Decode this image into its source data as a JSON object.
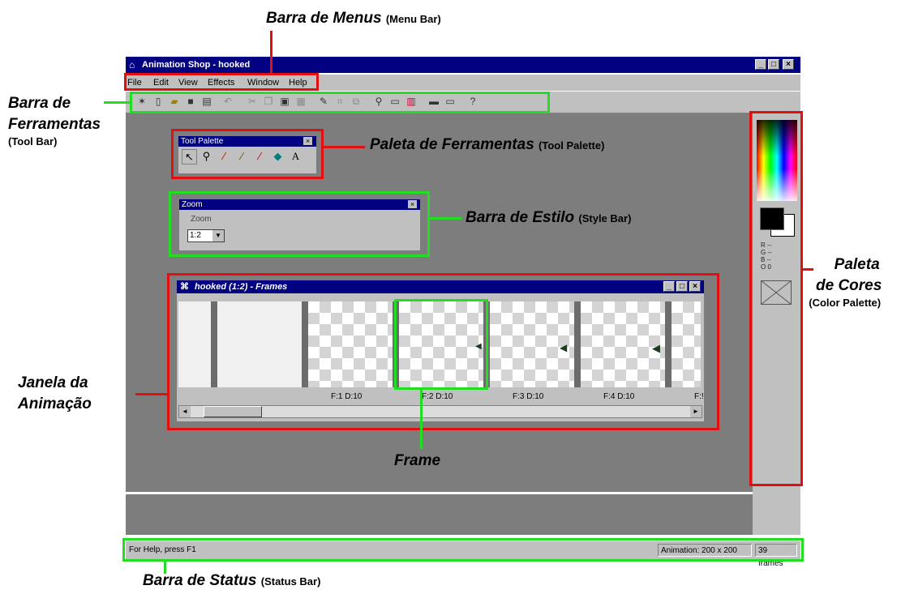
{
  "window": {
    "title": "Animation Shop - hooked",
    "minimize": "_",
    "maximize": "□",
    "close": "×"
  },
  "menu": [
    "File",
    "Edit",
    "View",
    "Effects",
    "Window",
    "Help"
  ],
  "tool_palette": {
    "title": "Tool Palette",
    "close": "×"
  },
  "style_bar": {
    "title": "Zoom",
    "close": "×",
    "label": "Zoom",
    "value": "1:2"
  },
  "frames_window": {
    "title": "hooked (1:2) - Frames",
    "frames": [
      {
        "label": "F:1  D:10"
      },
      {
        "label": "F:2  D:10"
      },
      {
        "label": "F:3  D:10"
      },
      {
        "label": "F:4  D:10"
      },
      {
        "label": "F:!"
      }
    ]
  },
  "color_palette": {
    "rgb": [
      "R --",
      "G --",
      "B --",
      "O 0"
    ]
  },
  "status": {
    "help": "For Help, press F1",
    "dimensions": "Animation: 200 x 200",
    "frames": "39 frames"
  },
  "annotations": {
    "menu_bar": "Barra de Menus",
    "menu_bar_en": "(Menu Bar)",
    "toolbar_1": "Barra de",
    "toolbar_2": "Ferramentas",
    "toolbar_en": "(Tool Bar)",
    "tool_palette": "Paleta de Ferramentas",
    "tool_palette_en": "(Tool Palette)",
    "style_bar": "Barra de Estilo",
    "style_bar_en": "(Style Bar)",
    "color_palette_1": "Paleta",
    "color_palette_2": "de Cores",
    "color_palette_en": "(Color Palette)",
    "anim_window_1": "Janela da",
    "anim_window_2": "Animação",
    "frame": "Frame",
    "status_bar": "Barra de Status",
    "status_bar_en": "(Status Bar)"
  },
  "colors": {
    "title_bar": "#000080",
    "workspace": "#7d7d7d",
    "highlight_red": "#e01010",
    "highlight_green": "#22dd22"
  }
}
